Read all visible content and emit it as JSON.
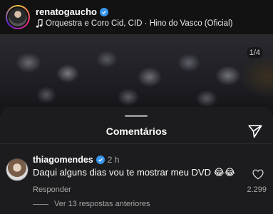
{
  "post": {
    "username": "renatogaucho",
    "audio": "Orquestra e Coro Cid, CID · Hino do Vasco (Oficial)",
    "counter": "1/4"
  },
  "comments_sheet": {
    "title": "Comentários",
    "comment": {
      "username": "thiagomendes",
      "time": "2 h",
      "text": "Daqui alguns dias vou te mostrar meu DVD 😂😂",
      "reply_label": "Responder",
      "likes": "2.299"
    },
    "more_replies": "Ver 13 respostas anteriores"
  },
  "colors": {
    "verified": "#3897f0",
    "sheet_bg": "#1c1c1e"
  },
  "icons": [
    "verified-icon",
    "music-note-icon",
    "share-send-icon",
    "heart-icon"
  ]
}
